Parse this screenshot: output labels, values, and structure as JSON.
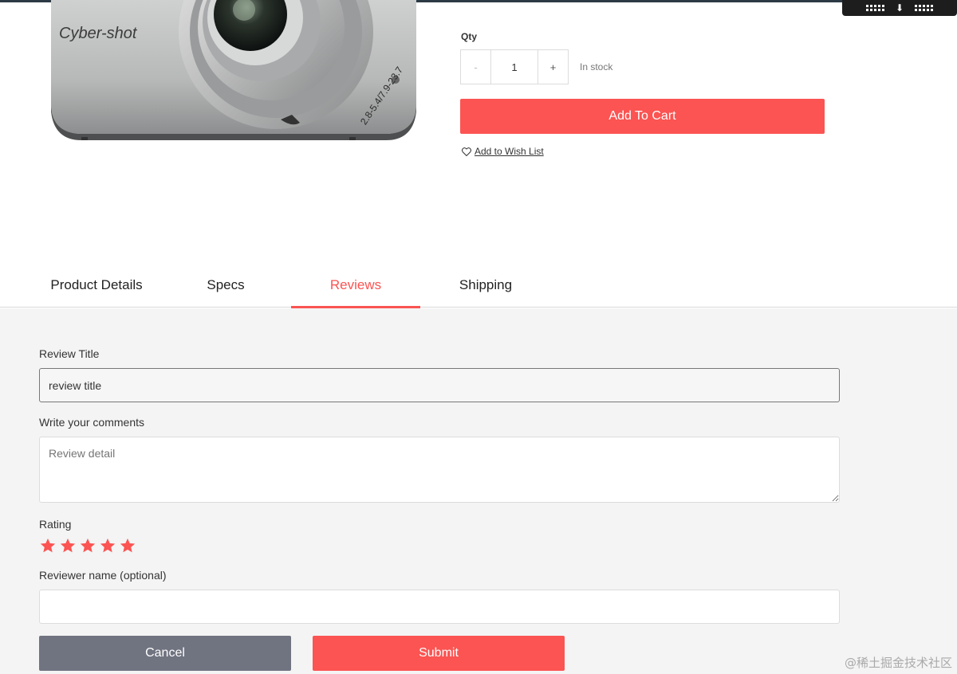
{
  "brand": {
    "accent": "#fb5452",
    "cancel_gray": "#707380"
  },
  "camera": {
    "logo_text": "Cyber-shot",
    "lens_text": "2.8-5.4/7.9-23.7"
  },
  "purchase": {
    "qty_label": "Qty",
    "minus_label": "-",
    "qty_value": "1",
    "plus_label": "+",
    "stock_status": "In stock",
    "add_to_cart_label": "Add To Cart",
    "wishlist_label": "Add to Wish List"
  },
  "tabs": [
    {
      "label": "Product Details",
      "active": false
    },
    {
      "label": "Specs",
      "active": false
    },
    {
      "label": "Reviews",
      "active": true
    },
    {
      "label": "Shipping",
      "active": false
    }
  ],
  "review_form": {
    "title_label": "Review Title",
    "title_value": "review title",
    "comments_label": "Write your comments",
    "comments_placeholder": "Review detail",
    "rating_label": "Rating",
    "rating_value": 5,
    "rating_max": 5,
    "name_label": "Reviewer name (optional)",
    "name_value": "",
    "cancel_label": "Cancel",
    "submit_label": "Submit"
  },
  "watermark": "@稀土掘金技术社区"
}
